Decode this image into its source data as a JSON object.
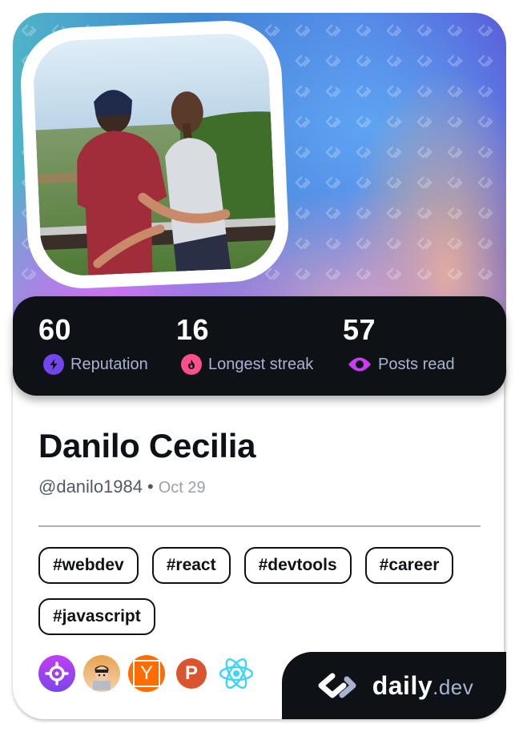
{
  "profile": {
    "name": "Danilo Cecilia",
    "handle": "@danilo1984",
    "separator": "•",
    "date": "Oct 29",
    "avatar_icon": "profile-photo"
  },
  "stats": [
    {
      "value": "60",
      "label": "Reputation",
      "icon": "lightning-icon",
      "color": "#7147ed"
    },
    {
      "value": "16",
      "label": "Longest streak",
      "icon": "flame-icon",
      "color": "#ff4f8a"
    },
    {
      "value": "57",
      "label": "Posts read",
      "icon": "eye-icon",
      "color": "#c93ef0"
    }
  ],
  "tags": [
    "#webdev",
    "#react",
    "#devtools",
    "#career",
    "#javascript"
  ],
  "sources": [
    {
      "name": "crosshair-source-icon",
      "color": "#9b3cf0"
    },
    {
      "name": "dev-squad-avatar",
      "color": "#e8a85a"
    },
    {
      "name": "hacker-news-icon",
      "letter": "Y",
      "color": "#ff6d00"
    },
    {
      "name": "product-hunt-icon",
      "letter": "P",
      "color": "#da552f"
    },
    {
      "name": "react-icon",
      "color": "#3fd4f5"
    }
  ],
  "brand": {
    "word": "daily",
    "tld": ".dev"
  },
  "colors": {
    "dark": "#0e1217",
    "muted": "#a8b3cf"
  }
}
